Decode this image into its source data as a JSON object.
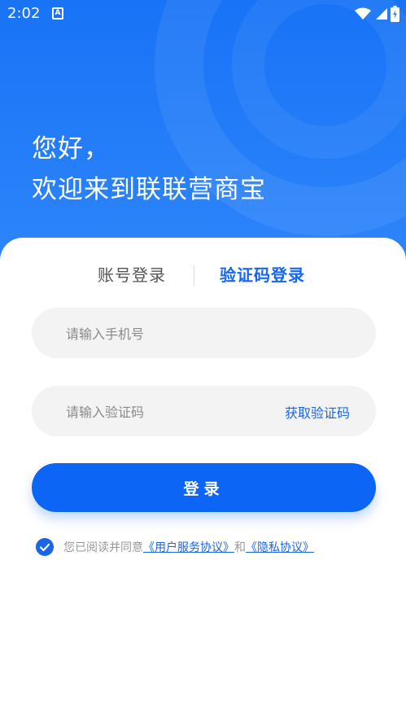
{
  "status_bar": {
    "time": "2:02",
    "app_icon_letter": "A",
    "icons": [
      "wifi-icon",
      "signal-icon",
      "battery-icon"
    ]
  },
  "header": {
    "greeting_line1": "您好，",
    "greeting_line2": "欢迎来到联联营商宝"
  },
  "tabs": {
    "account_login": "账号登录",
    "code_login": "验证码登录",
    "active": "code_login"
  },
  "form": {
    "phone_placeholder": "请输入手机号",
    "phone_value": "",
    "code_placeholder": "请输入验证码",
    "code_value": "",
    "get_code_label": "获取验证码",
    "login_label": "登录"
  },
  "agreement": {
    "checked": true,
    "prefix": "您已阅读并同意",
    "user_agreement": "《用户服务协议》",
    "connector": "和",
    "privacy_policy": "《隐私协议》"
  },
  "colors": {
    "primary": "#0d65f5",
    "header_bg": "#1873f6",
    "input_bg": "#f3f3f3",
    "muted_text": "#9a9a9a"
  }
}
